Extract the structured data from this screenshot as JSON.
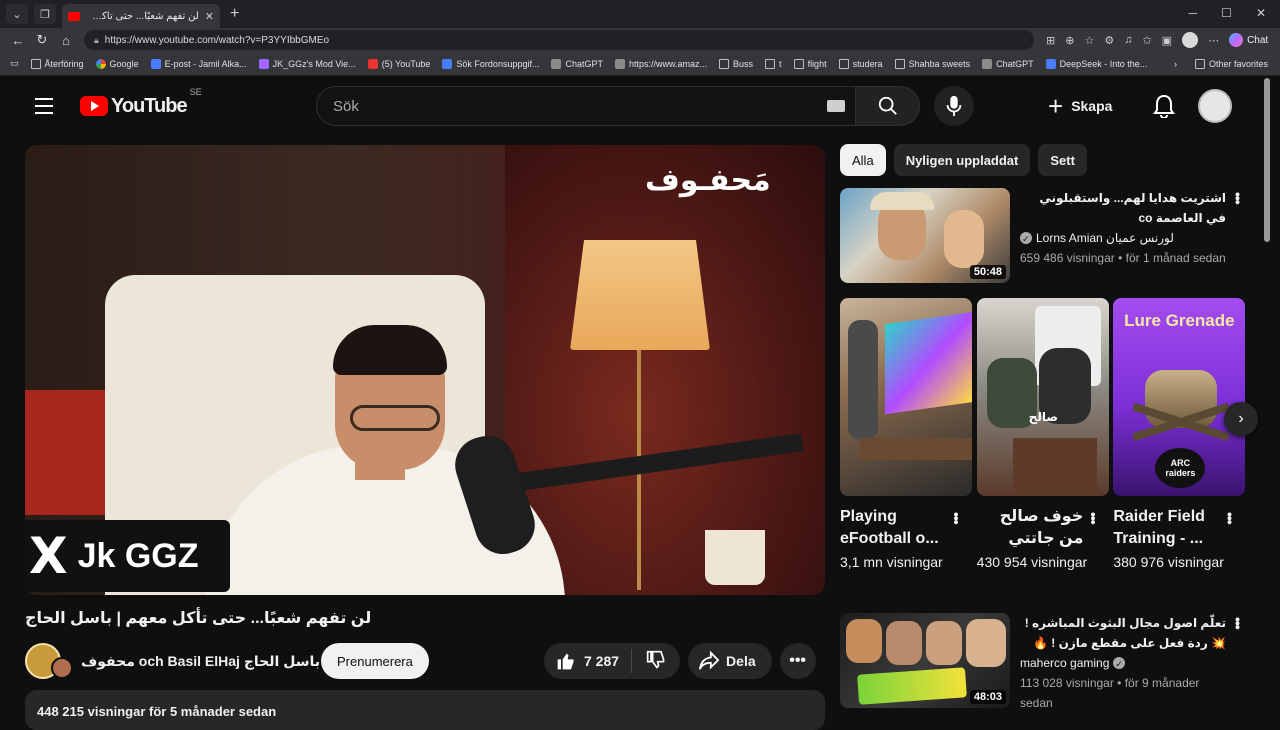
{
  "browser": {
    "tab_title": "لن تفهم شعبًا... حتى تأكل معهم | باس",
    "url": "https://www.youtube.com/watch?v=P3YYIbbGMEo",
    "chat_label": "Chat",
    "bookmarks": [
      {
        "label": "Återföring",
        "icon": "folder"
      },
      {
        "label": "Google",
        "icon": "google"
      },
      {
        "label": "E-post - Jamil Alka...",
        "icon": "blue"
      },
      {
        "label": "JK_GGz's Mod Vie...",
        "icon": "purple"
      },
      {
        "label": "(5) YouTube",
        "icon": "red"
      },
      {
        "label": "Sök Fordonsuppgif...",
        "icon": "blue"
      },
      {
        "label": "ChatGPT",
        "icon": "grey"
      },
      {
        "label": "https://www.amaz...",
        "icon": "grey"
      },
      {
        "label": "Buss",
        "icon": "folder"
      },
      {
        "label": "t",
        "icon": "folder"
      },
      {
        "label": "flight",
        "icon": "folder"
      },
      {
        "label": "studera",
        "icon": "folder"
      },
      {
        "label": "Shahba sweets",
        "icon": "folder"
      },
      {
        "label": "ChatGPT",
        "icon": "grey"
      },
      {
        "label": "DeepSeek - Into the...",
        "icon": "blue"
      }
    ],
    "other_favorites": "Other favorites"
  },
  "header": {
    "logo_text": "YouTube",
    "country_code": "SE",
    "search_placeholder": "Sök",
    "create_label": "Skapa"
  },
  "player": {
    "overlay_logo": "مَحفـوف",
    "badge_x": "X",
    "badge_name": "Jk GGZ"
  },
  "video": {
    "title": "لن تفهم شعبًا... حتى تأكل معهم | باسل الحاج",
    "channel": "محفوف och Basil ElHaj باسل الحاج",
    "subscribe_label": "Prenumerera",
    "likes": "7 287",
    "share_label": "Dela",
    "views_line": "448 215 visningar  för 5 månader sedan"
  },
  "chips": [
    "Alla",
    "Nyligen uppladdat",
    "Sett"
  ],
  "recommendations": [
    {
      "title": "اشتريت هدايا لهم... واستقبلوني في العاصمة co",
      "channel": "Lorns Amian لورنس عميان",
      "meta": "659 486 visningar • för 1 månad sedan",
      "duration": "50:48"
    },
    {
      "title": "تعلّم اصول مجال البثوث المباشره ! 💥 ردة فعل على مقطع مازن ! 🔥",
      "channel": "maherco gaming",
      "meta": "113 028 visningar • för 9 månader sedan",
      "duration": "48:03"
    }
  ],
  "shorts": [
    {
      "title": "Playing eFootball o...",
      "views": "3,1 mn visningar",
      "rtl": false
    },
    {
      "title": "خوف صالح من جاتتي شعبان...",
      "views": "430 954 visningar",
      "rtl": true
    },
    {
      "title": "Raider Field Training - ...",
      "views": "380 976 visningar",
      "rtl": false
    }
  ],
  "short_overlay_text": "Lure Grenade",
  "short_overlay_brand": "ARC raiders",
  "short2_overlay": "صالح"
}
